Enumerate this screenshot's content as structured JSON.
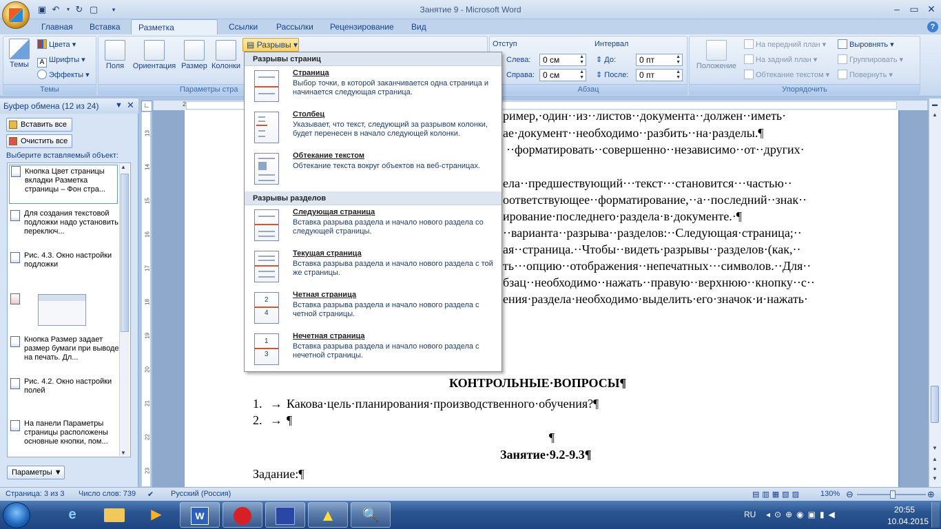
{
  "window": {
    "title": "Занятие 9 - Microsoft Word"
  },
  "tabs": [
    "Главная",
    "Вставка",
    "Разметка страницы",
    "Ссылки",
    "Рассылки",
    "Рецензирование",
    "Вид"
  ],
  "ribbon": {
    "themes": {
      "big": "Темы",
      "colors": "Цвета",
      "fonts": "Шрифты",
      "effects": "Эффекты",
      "label": "Темы"
    },
    "page_setup": {
      "fields": "Поля",
      "orientation": "Ориентация",
      "size": "Размер",
      "columns": "Колонки",
      "breaks": "Разрывы",
      "label": "Параметры стра"
    },
    "paragraph": {
      "indent": "Отступ",
      "spacing": "Интервал",
      "left_label": "Слева:",
      "left_value": "0 см",
      "right_label": "Справа:",
      "right_value": "0 см",
      "before_label": "До:",
      "before_value": "0 пт",
      "after_label": "После:",
      "after_value": "0 пт",
      "label": "Абзац"
    },
    "arrange": {
      "position": "Положение",
      "front": "На передний план",
      "back": "На задний план",
      "wrap": "Обтекание текстом",
      "align": "Выровнять",
      "group": "Группировать",
      "rotate": "Повернуть",
      "label": "Упорядочить"
    }
  },
  "dropdown": {
    "page_breaks_header": "Разрывы страниц",
    "section_breaks_header": "Разрывы разделов",
    "items": [
      {
        "title": "Страница",
        "desc": "Выбор точки, в которой заканчивается одна страница и начинается следующая страница."
      },
      {
        "title": "Столбец",
        "desc": "Указывает, что текст, следующий за разрывом колонки, будет перенесен в начало следующей колонки."
      },
      {
        "title": "Обтекание текстом",
        "desc": "Обтекание текста вокруг объектов на веб-страницах."
      },
      {
        "title": "Следующая страница",
        "desc": "Вставка разрыва раздела и начало нового раздела со следующей страницы."
      },
      {
        "title": "Текущая страница",
        "desc": "Вставка разрыва раздела и начало нового раздела с той же страницы."
      },
      {
        "title": "Четная страница",
        "desc": "Вставка разрыва раздела и начало нового раздела с четной страницы."
      },
      {
        "title": "Нечетная страница",
        "desc": "Вставка разрыва раздела и начало нового раздела с нечетной страницы."
      }
    ],
    "icon_numbers": [
      "2",
      "4",
      "1",
      "3"
    ]
  },
  "clipboard": {
    "title": "Буфер обмена (12 из 24)",
    "paste_all": "Вставить все",
    "clear_all": "Очистить все",
    "prompt": "Выберите вставляемый объект:",
    "items": [
      "Кнопка Цвет страницы вкладки Разметка страницы – Фон стра...",
      "Для создания текстовой подложки надо установить переключ...",
      "Рис. 4.3. Окно настройки подложки",
      "",
      "Кнопка Размер задает размер бумаги при выводе на печать. Дл...",
      "Рис. 4.2. Окно настройки полей",
      "На панели Параметры страницы расположены основные кнопки, пом..."
    ],
    "options": "Параметры"
  },
  "document": {
    "lines": [
      "ример,·один··из··листов··документа··должен··иметь·",
      "ае·документ··необходимо··разбить··на·разделы.¶",
      "··форматировать··совершенно··независимо··от··других·",
      "ела··предшествующий···текст···становится···частью··",
      "оответствующее··форматирование,··а··последний··знак··",
      "ирование·последнего·раздела·в·документе.·¶",
      "··варианта··разрыва··разделов:··Следующая·страница;··",
      "ая··страница.··Чтобы··видеть·разрывы··разделов·(как,··",
      "ть···опцию··отображения··непечатных···символов.··Для··",
      "бзац··необходимо··нажать··правую··верхнюю··кнопку··с··",
      "ения·раздела·необходимо·выделить·его·значок·и·нажать·"
    ],
    "heading": "КОНТРОЛЬНЫЕ·ВОПРОСЫ¶",
    "q1_num": "1.",
    "q1_text": "Какова·цель·планирования·производственного·обучения?¶",
    "q2_num": "2.",
    "q2_text": "¶",
    "empty_para": "¶",
    "lesson": "Занятие·9.2-9.3¶",
    "task": "Задание:¶"
  },
  "ruler": {
    "h_numbers": [
      "2",
      "1",
      "1",
      "2",
      "3",
      "4",
      "5",
      "6",
      "7",
      "8",
      "9",
      "10",
      "11",
      "12",
      "13",
      "14",
      "15",
      "16",
      "17",
      "18"
    ],
    "v_numbers": [
      "13",
      "14",
      "15",
      "16",
      "17",
      "18",
      "19",
      "20",
      "21",
      "22",
      "23",
      "24"
    ]
  },
  "statusbar": {
    "page": "Страница: 3 из 3",
    "words": "Число слов: 739",
    "language": "Русский (Россия)",
    "zoom": "130%"
  },
  "taskbar": {
    "lang": "RU",
    "time": "20:55",
    "date": "10.04.2015"
  }
}
